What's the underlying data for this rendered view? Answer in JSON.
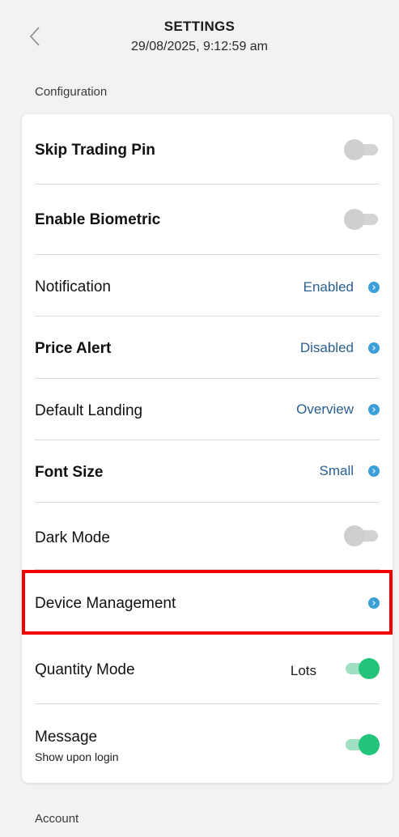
{
  "header": {
    "back_icon": "chevron-left-icon",
    "title": "SETTINGS",
    "datetime": "29/08/2025, 9:12:59 am"
  },
  "sections": {
    "configuration": "Configuration",
    "account": "Account"
  },
  "settings": [
    {
      "label": "Skip Trading Pin",
      "control": "toggle",
      "on": false
    },
    {
      "label": "Enable Biometric",
      "control": "toggle",
      "on": false
    },
    {
      "label": "Notification",
      "value": "Enabled",
      "control": "chevron"
    },
    {
      "label": "Price Alert",
      "value": "Disabled",
      "control": "chevron"
    },
    {
      "label": "Default Landing",
      "value": "Overview",
      "control": "chevron"
    },
    {
      "label": "Font Size",
      "value": "Small",
      "control": "chevron"
    },
    {
      "label": "Dark Mode",
      "control": "toggle",
      "on": false
    },
    {
      "label": "Device Management",
      "control": "chevron",
      "highlighted": true
    },
    {
      "label": "Quantity Mode",
      "value": "Lots",
      "control": "toggle",
      "on": true
    },
    {
      "label": "Message",
      "sublabel": "Show upon login",
      "control": "toggle",
      "on": true
    }
  ],
  "colors": {
    "accent": "#3d9fd8",
    "toggle_on": "#22c47a",
    "highlight": "#f00000"
  }
}
